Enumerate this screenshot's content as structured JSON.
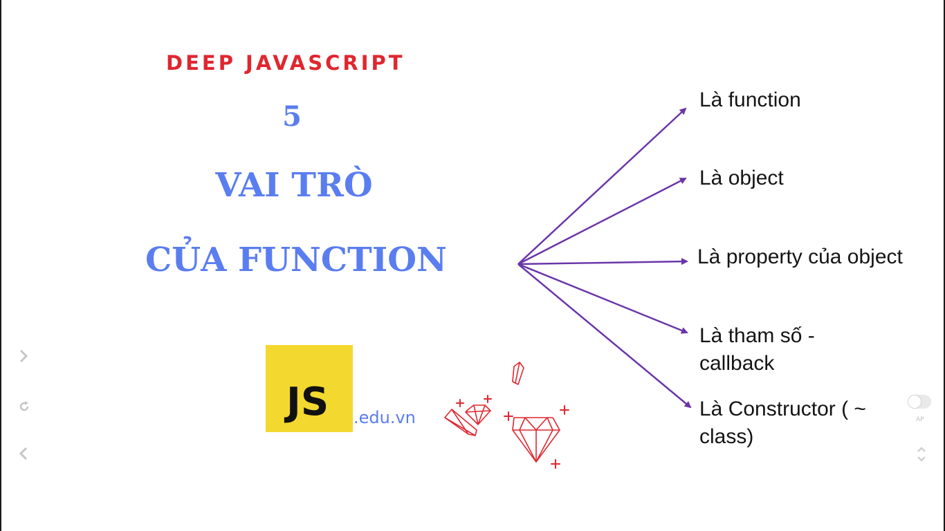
{
  "slide": {
    "kicker": "DEEP JAVASCRIPT",
    "number": "5",
    "title_line1": "VAI TRÒ",
    "title_line2": "CỦA FUNCTION",
    "roles": [
      "Là function",
      "Là object",
      "Là property của object",
      "Là tham số - callback",
      "Là Constructor ( ~ class)"
    ],
    "logo": {
      "mark": "JS",
      "domain": ".edu.vn"
    },
    "colors": {
      "kicker": "#e0262f",
      "title": "#5a7df0",
      "arrows": "#6a35a8",
      "logo_bg": "#f3d830",
      "gems": "#e0262f"
    }
  },
  "viewer": {
    "icons": [
      "chevron-right-icon",
      "refresh-icon",
      "chevron-left-icon",
      "toggle-switch",
      "scroll-updown-icon"
    ],
    "toggle_label": "AP"
  }
}
